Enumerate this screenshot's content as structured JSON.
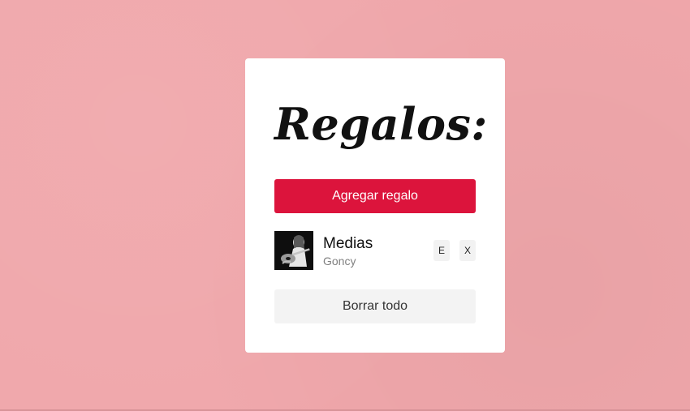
{
  "app": {
    "title": "Regalos:"
  },
  "actions": {
    "add_label": "Agregar regalo",
    "clear_label": "Borrar todo"
  },
  "gifts": [
    {
      "name": "Medias",
      "recipient": "Goncy",
      "image": "guitarist-photo",
      "edit_label": "E",
      "delete_label": "X"
    }
  ],
  "colors": {
    "background": "#f0a7ab",
    "primary": "#dc143c",
    "card": "#ffffff",
    "secondary_button": "#f3f3f3"
  }
}
